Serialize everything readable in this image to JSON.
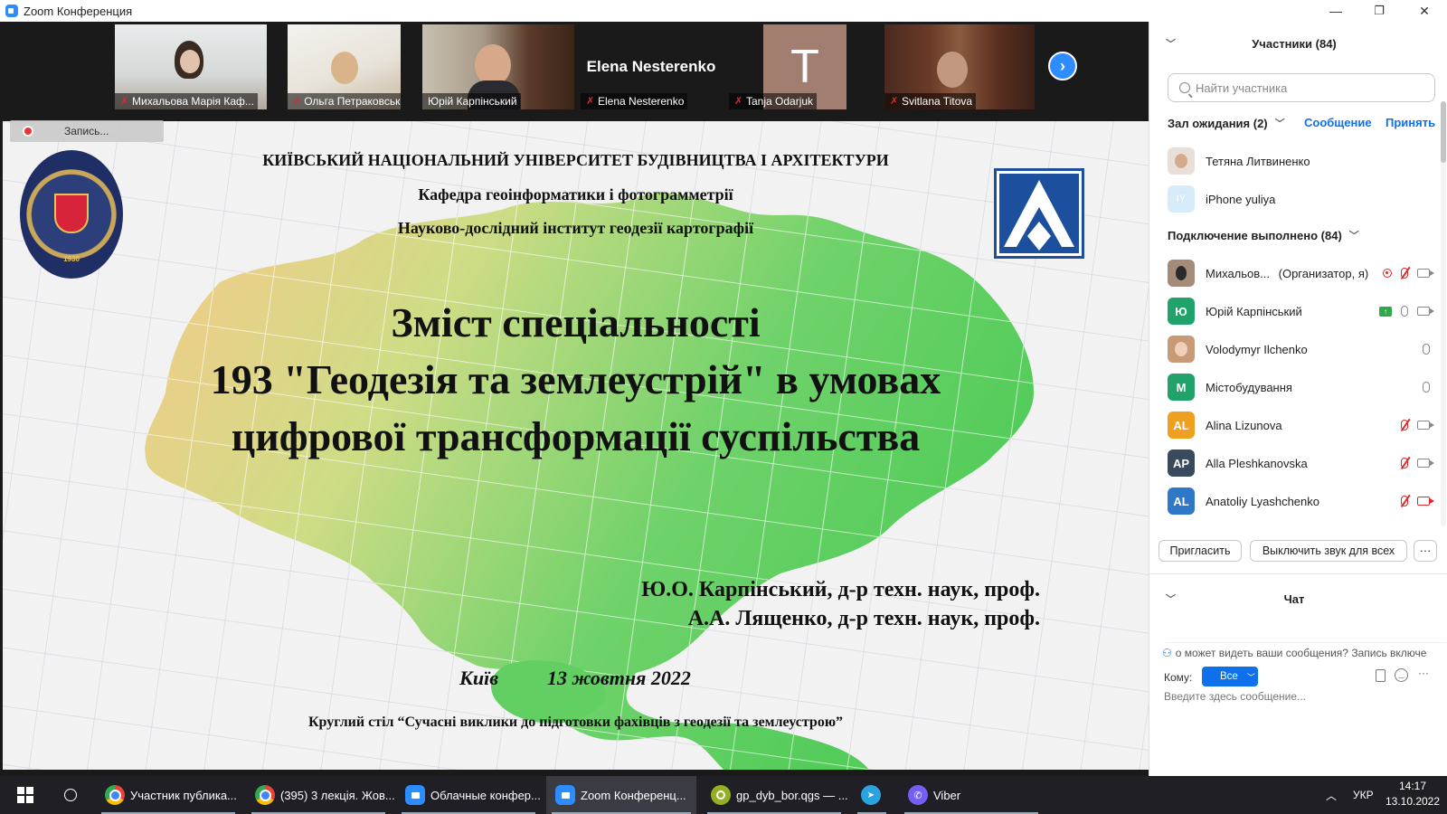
{
  "window": {
    "title": "Zoom Конференция",
    "minimize": "—",
    "restore": "❐",
    "close": "✕"
  },
  "gallery": {
    "tiles": [
      {
        "name": "Михальова Марія Каф..."
      },
      {
        "name": "Ольга Петраковська"
      },
      {
        "name": "Юрій Карпінський"
      },
      {
        "name": "Elena Nesterenko",
        "big_label": "Elena Nesterenko"
      },
      {
        "name": "Tanja Odarjuk",
        "initial": "T"
      },
      {
        "name": "Svitlana Titova"
      }
    ],
    "next": "›"
  },
  "recording": {
    "label": "Запись..."
  },
  "slide": {
    "university": "КИЇВСЬКИЙ НАЦІОНАЛЬНИЙ УНІВЕРСИТЕТ БУДІВНИЦТВА І АРХІТЕКТУРИ",
    "department": "Кафедра геоінформатики і фотограмметрії",
    "institute": "Науково-дослідний інститут геодезії картографії",
    "title_line1": "Зміст спеціальності",
    "title_line2": "193 \"Геодезія та землеустрій\"  в умовах",
    "title_line3": "цифрової трансформації суспільства",
    "author1": "Ю.О.  Карпінський, д-р техн. наук, проф.",
    "author2": "А.А. Лященко, д-р техн. наук, проф.",
    "city": "Київ",
    "date": "13 жовтня 2022",
    "footer": "Круглий стіл  “Сучасні виклики до підготовки фахівців з геодезії та землеустрою”",
    "seal_year": "1930"
  },
  "participants": {
    "header": "Участники (84)",
    "search_placeholder": "Найти участника",
    "waiting": {
      "label": "Зал ожидания (2)",
      "message": "Сообщение",
      "admit": "Принять",
      "people": [
        {
          "name": "Тетяна Литвиненко",
          "avatar_color": "#e8e0d8"
        },
        {
          "name": "iPhone yuliya",
          "initials": "IY",
          "avatar_color": "#d6ecfb"
        }
      ]
    },
    "connected": {
      "label": "Подключение выполнено (84)",
      "people": [
        {
          "name": "Михальов...",
          "role": "(Организатор, я)",
          "avatar_color": "#a58b79"
        },
        {
          "name": "Юрій Карпінський",
          "initials": "Ю",
          "avatar_color": "#1fa36b"
        },
        {
          "name": "Volodymyr Ilchenko",
          "avatar_color": "#c89a76"
        },
        {
          "name": "Містобудування",
          "initials": "M",
          "avatar_color": "#1fa36b"
        },
        {
          "name": "Alina Lizunova",
          "initials": "AL",
          "avatar_color": "#f0a020"
        },
        {
          "name": "Alla Pleshkanovska",
          "initials": "AP",
          "avatar_color": "#3a4a5e"
        },
        {
          "name": "Anatoliy Lyashchenko",
          "initials": "AL",
          "avatar_color": "#2f78c8"
        }
      ]
    },
    "invite": "Пригласить",
    "mute_all": "Выключить звук для всех",
    "more": "···"
  },
  "chat": {
    "header": "Чат",
    "notice": "о может видеть ваши сообщения? Запись включе",
    "to_label": "Кому:",
    "to_value": "Все",
    "input_placeholder": "Введите здесь сообщение...",
    "more": "···"
  },
  "taskbar": {
    "items": [
      {
        "label": "Участник публика...",
        "color": "#ea4335"
      },
      {
        "label": "(395) 3 лекція. Жов...",
        "color": "#ea4335"
      },
      {
        "label": "Облачные конфер...",
        "color": "#2d8cff"
      },
      {
        "label": "Zoom Конференц...",
        "color": "#2d8cff"
      },
      {
        "label": "gp_dyb_bor.qgs — ...",
        "color": "#93b023"
      },
      {
        "label": "",
        "color": "#2aa3e0"
      },
      {
        "label": "Viber",
        "color": "#7360f2"
      }
    ],
    "lang": "УКР",
    "time": "14:17",
    "date": "13.10.2022",
    "tray_chevron": "︿"
  }
}
